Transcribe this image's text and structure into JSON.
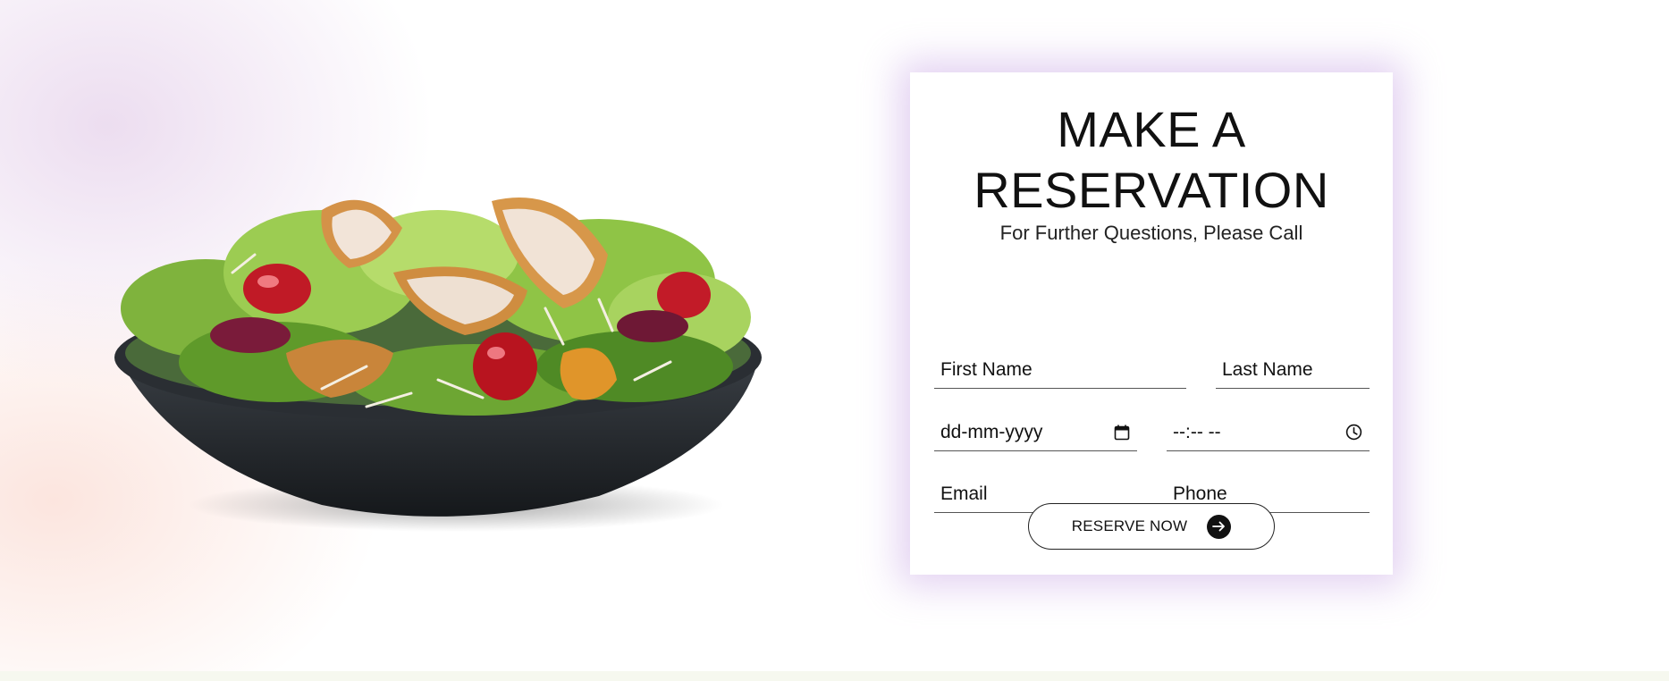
{
  "reservation": {
    "title_line1": "MAKE A",
    "title_line2": "RESERVATION",
    "subtitle": "For Further Questions, Please Call",
    "fields": {
      "first_name": "First Name",
      "last_name": "Last Name",
      "date": "dd-mm-yyyy",
      "time": "--:-- --",
      "email": "Email",
      "phone": "Phone"
    },
    "button_label": "RESERVE NOW"
  },
  "icons": {
    "date": "calendar-icon",
    "time": "clock-icon",
    "button": "arrow-right-icon"
  },
  "colors": {
    "card_glow": "#c9a3e6",
    "button_circle": "#111111",
    "footer_strip": "#f6f8ef"
  }
}
